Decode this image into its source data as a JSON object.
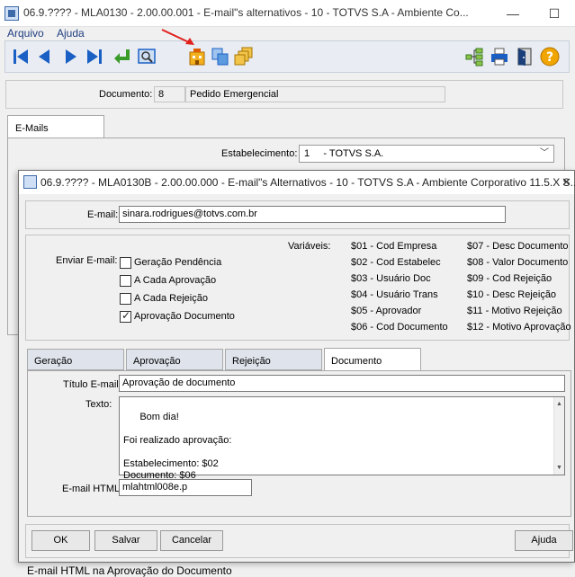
{
  "main_window": {
    "title": "06.9.???? - MLA0130 - 2.00.00.001 - E-mail\"s alternativos - 10 - TOTVS S.A - Ambiente Co...",
    "minimize": "—",
    "maximize": "☐"
  },
  "menu": [
    "Arquivo",
    "Ajuda"
  ],
  "header": {
    "documento_label": "Documento:",
    "documento_value": "8",
    "documento_desc": "Pedido Emergencial"
  },
  "mail_tab": "E-Mails",
  "estab": {
    "label": "Estabelecimento:",
    "value": "1     - TOTVS S.A."
  },
  "dialog": {
    "title": "06.9.???? - MLA0130B - 2.00.00.000 - E-mail\"s Alternativos - 10 - TOTVS S.A - Ambiente Corporativo 11.5.X S...",
    "close": "✕",
    "email_label": "E-mail:",
    "email_value": "sinara.rodrigues@totvs.com.br",
    "enviar_label": "Enviar E-mail:",
    "checks": [
      {
        "label": "Geração Pendência",
        "checked": false
      },
      {
        "label": "A Cada Aprovação",
        "checked": false
      },
      {
        "label": "A Cada Rejeição",
        "checked": false
      },
      {
        "label": "Aprovação Documento",
        "checked": true
      }
    ],
    "variaveis_label": "Variáveis:",
    "vars_col1": [
      "$01 - Cod Empresa",
      "$02 - Cod Estabelec",
      "$03 - Usuário Doc",
      "$04 - Usuário Trans",
      "$05 - Aprovador",
      "$06 - Cod Documento"
    ],
    "vars_col2": [
      "$07 - Desc Documento",
      "$08 - Valor Documento",
      "$09 - Cod Rejeição",
      "$10 - Desc Rejeição",
      "$11 - Motivo Rejeição",
      "$12 - Motivo Aprovação"
    ],
    "tabs": [
      "Geração",
      "Aprovação",
      "Rejeição",
      "Documento"
    ],
    "active_tab": "Documento",
    "titulo_label": "Título E-mail:",
    "titulo_value": "Aprovação de documento",
    "texto_label": "Texto:",
    "texto_value": "Bom dia!\n\nFoi realizado aprovação:\n\nEstabelecimento: $02\nDocumento: $06",
    "html_label": "E-mail HTML:",
    "html_value": "mlahtml008e.p",
    "buttons": {
      "ok": "OK",
      "salvar": "Salvar",
      "cancelar": "Cancelar",
      "ajuda": "Ajuda"
    }
  },
  "status_text": "E-mail HTML na Aprovação do Documento"
}
